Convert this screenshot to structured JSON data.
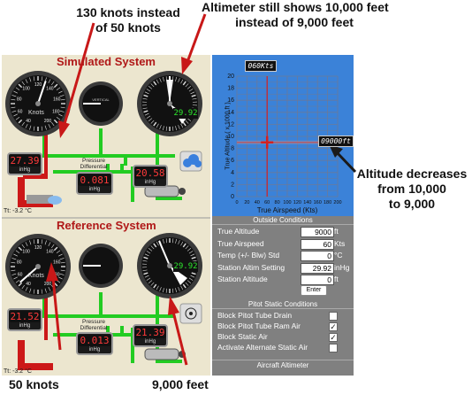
{
  "callouts": {
    "top_left": [
      "130 knots instead",
      "of 50 knots"
    ],
    "top_right": [
      "Altimeter still shows 10,000 feet",
      "instead of 9,000 feet"
    ],
    "right": [
      "Altitude decreases",
      "from 10,000",
      "to 9,000"
    ],
    "bottom_left": "50 knots",
    "bottom_right": "9,000 feet"
  },
  "simulated": {
    "title": "Simulated System",
    "kollsman": "29.92",
    "lcd_left": "27.39",
    "lcd_left_unit": "inHg",
    "pressure_label": [
      "Pressure",
      "Differential"
    ],
    "lcd_diff": "0.081",
    "lcd_diff_unit": "inHg",
    "lcd_right": "20.58",
    "lcd_right_unit": "inHg",
    "temp": "Tt: -3.2 °C",
    "airspeed_unit": "Knots",
    "airspeed_ticks": [
      "40",
      "60",
      "80",
      "100",
      "120",
      "140",
      "160",
      "180",
      "200"
    ],
    "airspeed_reading_knots": 130
  },
  "reference": {
    "title": "Reference System",
    "kollsman": "29.92",
    "lcd_left": "21.52",
    "lcd_left_unit": "inHg",
    "pressure_label": [
      "Pressure",
      "Differential"
    ],
    "lcd_diff": "0.013",
    "lcd_diff_unit": "inHg",
    "lcd_right": "21.39",
    "lcd_right_unit": "inHg",
    "temp": "Tt: -3.2 °C",
    "airspeed_unit": "Knots",
    "airspeed_ticks": [
      "40",
      "60",
      "80",
      "100",
      "120",
      "140",
      "160",
      "180",
      "200"
    ],
    "airspeed_reading_knots": 50
  },
  "chart": {
    "speed_readout": "060Kts",
    "alt_readout": "09000ft",
    "ylabel": "True Altitude  ( x 1000 ft )",
    "xlabel": "True Airspeed (Kts)",
    "y_ticks": [
      "20",
      "18",
      "16",
      "14",
      "12",
      "10",
      "8",
      "6",
      "4",
      "2",
      "0"
    ],
    "x_ticks": [
      "0",
      "20",
      "40",
      "60",
      "80",
      "100",
      "120",
      "140",
      "160",
      "180",
      "200"
    ],
    "marker": {
      "airspeed_kts": 60,
      "altitude_kft": 9
    },
    "colors": {
      "background": "#3b82d8",
      "grid": "#6a7a9a",
      "crosshair": "#d42020"
    }
  },
  "outside_conditions": {
    "header": "Outside Conditions",
    "rows": [
      {
        "label": "True Altitude",
        "value": "9000",
        "unit": "ft"
      },
      {
        "label": "True Airspeed",
        "value": "60",
        "unit": "Kts"
      },
      {
        "label": "Temp (+/- Blw) Std",
        "value": "0",
        "unit": "°C"
      },
      {
        "label": "Station Altim Setting",
        "value": "29.92",
        "unit": "inHg"
      },
      {
        "label": "Station Altitude",
        "value": "0",
        "unit": "ft"
      }
    ],
    "enter_label": "Enter"
  },
  "pitot_static": {
    "header": "Pitot Static Conditions",
    "items": [
      {
        "label": "Block Pitot Tube Drain",
        "checked": false
      },
      {
        "label": "Block Pitot Tube Ram Air",
        "checked": true
      },
      {
        "label": "Block Static Air",
        "checked": true
      },
      {
        "label": "Activate Alternate Static Air",
        "checked": false
      }
    ]
  },
  "footer": "Aircraft Altimeter"
}
